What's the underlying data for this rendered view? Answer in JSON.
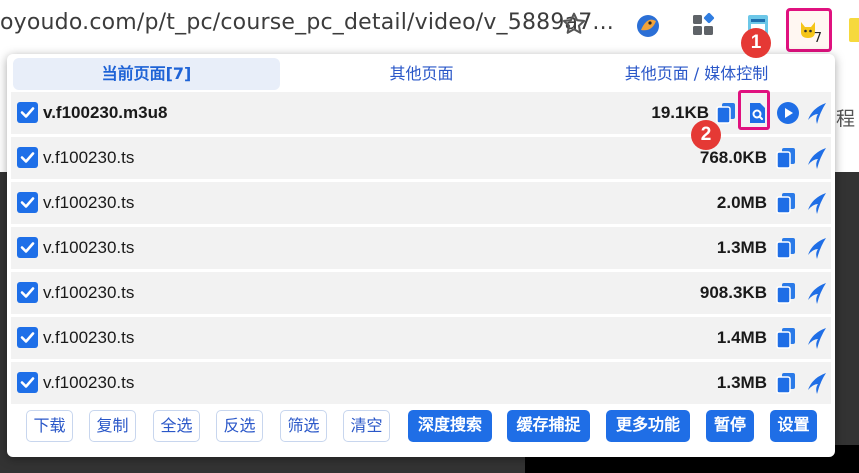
{
  "browser": {
    "url": "oyoudo.com/p/t_pc/course_pc_detail/video/v_5889a7...",
    "extension_badge_count": "7",
    "page_side_char": "程"
  },
  "callouts": [
    "1",
    "2"
  ],
  "popup": {
    "tabs": [
      {
        "label": "当前页面[7]",
        "active": true
      },
      {
        "label": "其他页面",
        "active": false
      },
      {
        "label": "其他页面 / 媒体控制",
        "active": false
      }
    ],
    "rows": [
      {
        "name": "v.f100230.m3u8",
        "size": "19.1KB",
        "checked": true
      },
      {
        "name": "v.f100230.ts",
        "size": "768.0KB",
        "checked": true
      },
      {
        "name": "v.f100230.ts",
        "size": "2.0MB",
        "checked": true
      },
      {
        "name": "v.f100230.ts",
        "size": "1.3MB",
        "checked": true
      },
      {
        "name": "v.f100230.ts",
        "size": "908.3KB",
        "checked": true
      },
      {
        "name": "v.f100230.ts",
        "size": "1.4MB",
        "checked": true
      },
      {
        "name": "v.f100230.ts",
        "size": "1.3MB",
        "checked": true
      }
    ],
    "buttons": {
      "download": "下载",
      "copy": "复制",
      "select_all": "全选",
      "invert": "反选",
      "filter": "筛选",
      "clear": "清空",
      "deep_search": "深度搜索",
      "cache_capture": "缓存捕捉",
      "more": "更多功能",
      "pause": "暂停",
      "settings": "设置"
    }
  },
  "colors": {
    "accent": "#1f6ee6",
    "highlight": "#e0117f",
    "callout": "#e53935",
    "row_bg": "#f2f2f2",
    "page_dark": "#333333"
  }
}
